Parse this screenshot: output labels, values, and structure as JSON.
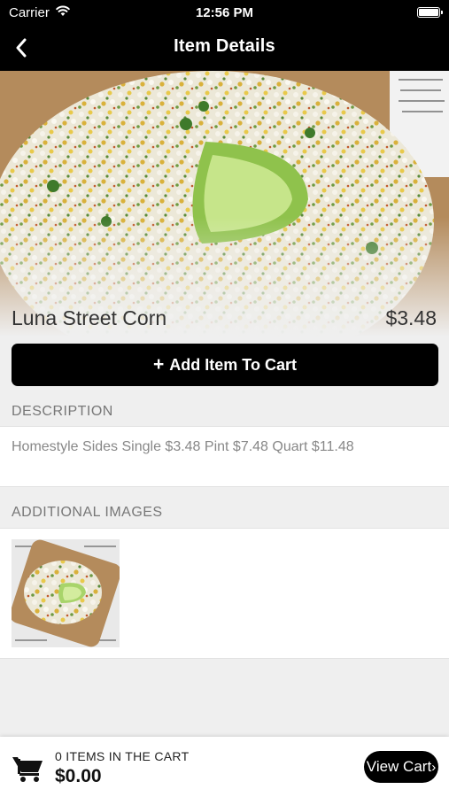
{
  "status_bar": {
    "carrier": "Carrier",
    "time": "12:56 PM"
  },
  "nav": {
    "title": "Item Details"
  },
  "item": {
    "name": "Luna Street Corn",
    "price": "$3.48"
  },
  "add_button": {
    "icon": "+",
    "label": "Add Item To Cart"
  },
  "description": {
    "header": "DESCRIPTION",
    "text": "Homestyle Sides Single $3.48 Pint $7.48 Quart $11.48"
  },
  "additional_images": {
    "header": "ADDITIONAL IMAGES"
  },
  "cart": {
    "count_label": "0 ITEMS IN THE CART",
    "total": "$0.00",
    "view_cart_label": "View Cart",
    "view_cart_chevron": "›"
  },
  "colors": {
    "bar": "#000000",
    "background": "#efefef",
    "button": "#000000",
    "muted_text": "#777777"
  },
  "icons": [
    "wifi-icon",
    "battery-icon",
    "back-chevron-icon",
    "cart-icon"
  ]
}
